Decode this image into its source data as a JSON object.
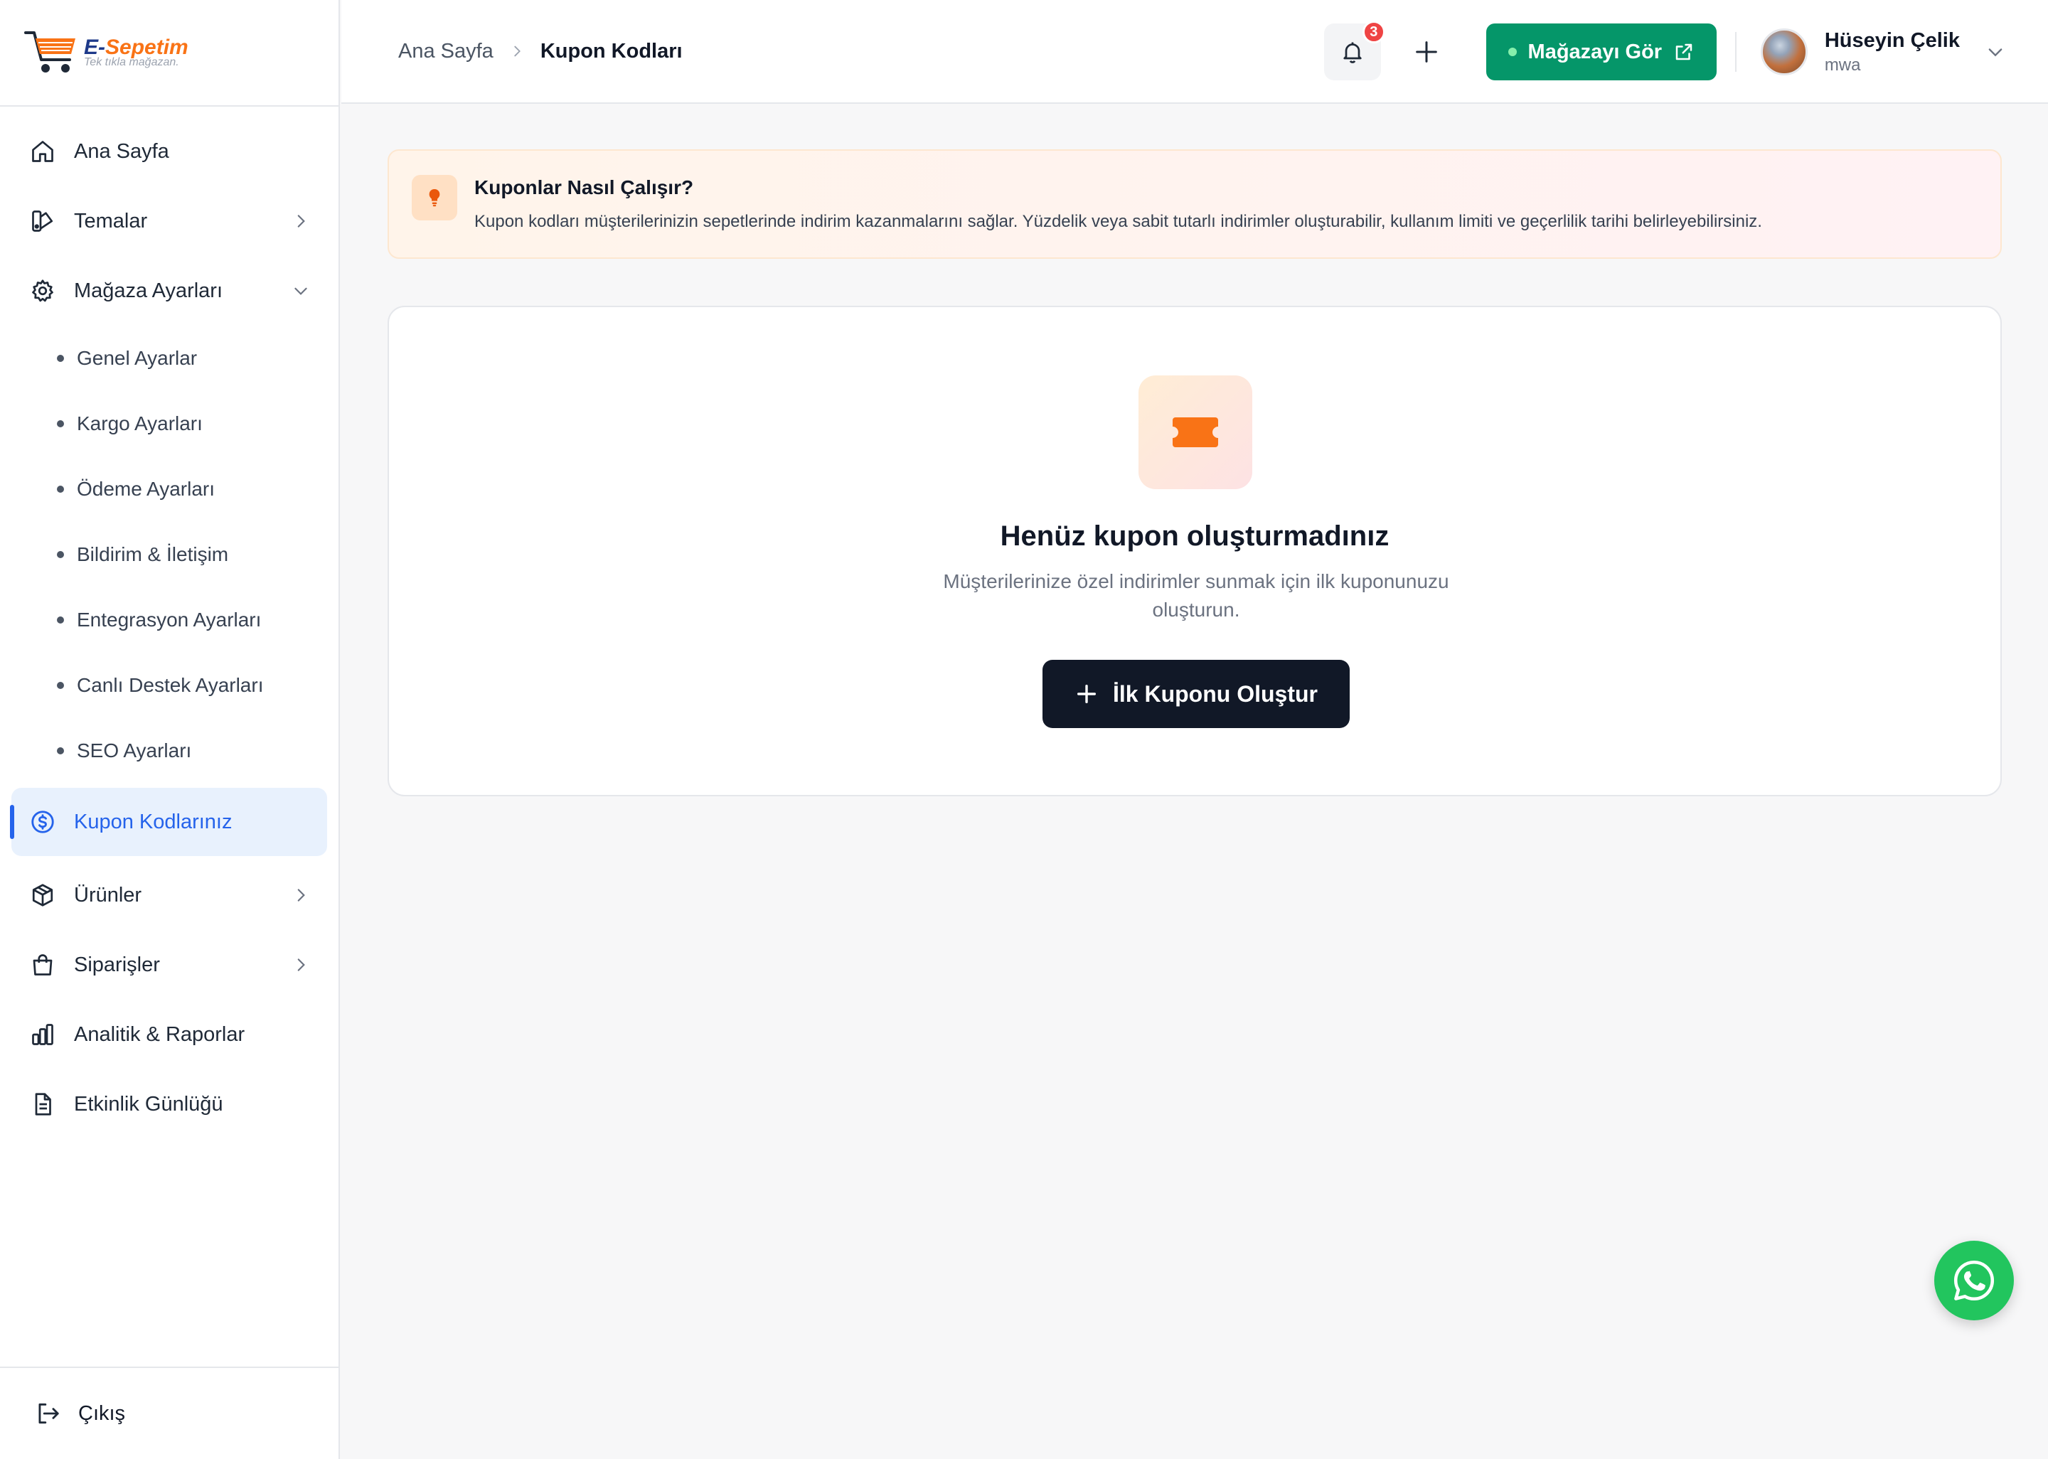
{
  "brand": {
    "name_prefix": "E-",
    "name_rest": "Sepetim",
    "tagline": "Tek tıkla mağazan."
  },
  "sidebar": {
    "items": [
      {
        "label": "Ana Sayfa",
        "icon": "home-icon"
      },
      {
        "label": "Temalar",
        "icon": "theme-icon"
      },
      {
        "label": "Mağaza Ayarları",
        "icon": "gear-icon",
        "expanded": true
      }
    ],
    "sub_items": [
      "Genel Ayarlar",
      "Kargo Ayarları",
      "Ödeme Ayarları",
      "Bildirim & İletişim",
      "Entegrasyon Ayarları",
      "Canlı Destek Ayarları",
      "SEO Ayarları"
    ],
    "active_item": {
      "label": "Kupon Kodlarınız",
      "icon": "dollar-circle-icon"
    },
    "items_after": [
      {
        "label": "Ürünler",
        "icon": "box-icon"
      },
      {
        "label": "Siparişler",
        "icon": "shopping-bag-icon"
      },
      {
        "label": "Analitik & Raporlar",
        "icon": "bar-chart-icon"
      },
      {
        "label": "Etkinlik Günlüğü",
        "icon": "document-icon"
      }
    ],
    "logout": "Çıkış"
  },
  "header": {
    "breadcrumb_home": "Ana Sayfa",
    "breadcrumb_current": "Kupon Kodları",
    "notification_count": "3",
    "store_button": "Mağazayı Gör",
    "user_name": "Hüseyin Çelik",
    "user_sub": "mwa"
  },
  "info": {
    "title": "Kuponlar Nasıl Çalışır?",
    "description": "Kupon kodları müşterilerinizin sepetlerinde indirim kazanmalarını sağlar. Yüzdelik veya sabit tutarlı indirimler oluşturabilir, kullanım limiti ve geçerlilik tarihi belirleyebilirsiniz."
  },
  "empty_state": {
    "title": "Henüz kupon oluşturmadınız",
    "description": "Müşterilerinize özel indirimler sunmak için ilk kuponunuzu oluşturun.",
    "button": "İlk Kuponu Oluştur"
  },
  "colors": {
    "accent": "#2563eb",
    "store_button": "#059669",
    "primary_dark": "#111827",
    "coupon_orange": "#f97316",
    "whatsapp": "#22c55e",
    "badge": "#ef4444"
  }
}
